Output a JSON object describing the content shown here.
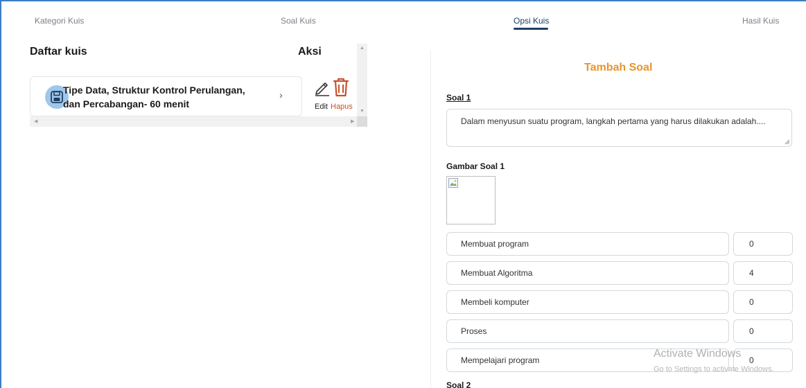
{
  "nav": {
    "tabs": [
      {
        "label": "Kategori Kuis"
      },
      {
        "label": "Soal Kuis"
      },
      {
        "label": "Opsi Kuis",
        "active": true
      },
      {
        "label": "Hasil Kuis"
      }
    ]
  },
  "quiz_list": {
    "title": "Daftar kuis",
    "action_header": "Aksi",
    "items": [
      {
        "line1": "Tipe Data, Struktur Kontrol Perulangan,",
        "line2": "dan Percabangan- 60 menit",
        "icon": "floppy-disk-icon",
        "edit_label": "Edit",
        "delete_label": "Hapus"
      }
    ]
  },
  "form": {
    "title": "Tambah Soal",
    "question_label": "Soal 1",
    "question_text": "Dalam menyusun suatu program, langkah pertama yang harus dilakukan adalah....",
    "image_label": "Gambar Soal 1",
    "options": [
      {
        "text": "Membuat program",
        "score": "0"
      },
      {
        "text": "Membuat Algoritma",
        "score": "4"
      },
      {
        "text": "Membeli komputer",
        "score": "0"
      },
      {
        "text": "Proses",
        "score": "0"
      },
      {
        "text": "Mempelajari program",
        "score": "0"
      }
    ],
    "next_question_label": "Soal 2"
  },
  "watermark": {
    "title": "Activate Windows",
    "subtitle": "Go to Settings to activate Windows."
  },
  "colors": {
    "accent_orange": "#e8952e",
    "nav_active": "#1f3f61",
    "delete_red": "#c8502c",
    "icon_bg": "#9fc7ea"
  }
}
